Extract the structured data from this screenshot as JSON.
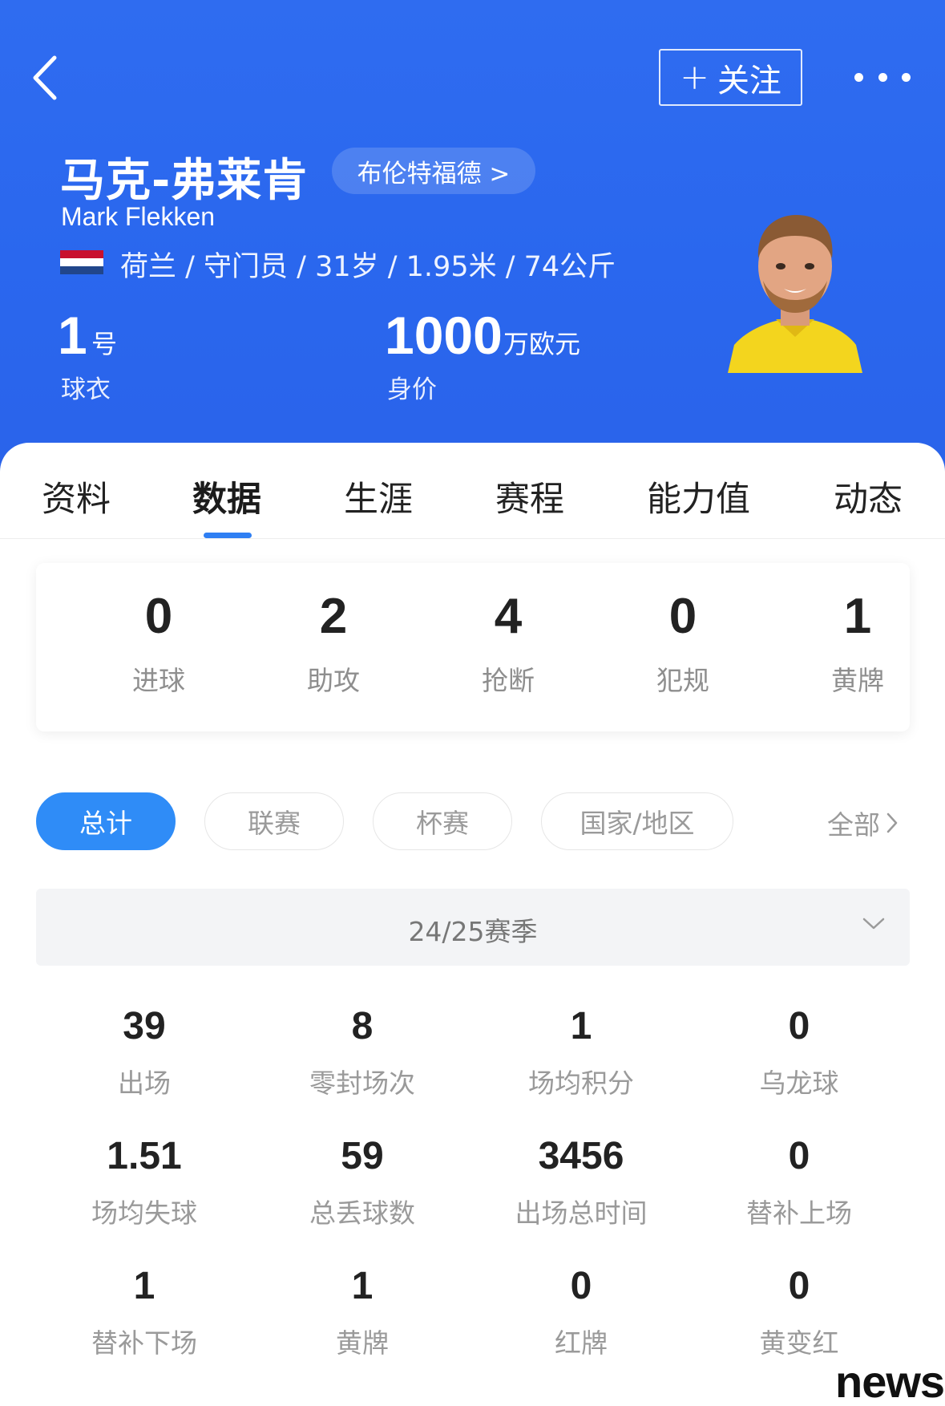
{
  "header": {
    "follow_plus": "+",
    "follow_label": "关注",
    "name_cn": "马克-弗莱肯",
    "team": "布伦特福德 >",
    "name_en": "Mark Flekken",
    "meta": "荷兰 / 守门员 / 31岁 / 1.95米 / 74公斤",
    "flag_colors": [
      "#c8102e",
      "#ffffff",
      "#21468b"
    ],
    "jersey": {
      "number": "1",
      "unit": "号",
      "label": "球衣"
    },
    "value": {
      "number": "1000",
      "unit": "万欧元",
      "label": "身价"
    }
  },
  "tabs": [
    {
      "label": "资料"
    },
    {
      "label": "数据"
    },
    {
      "label": "生涯"
    },
    {
      "label": "赛程"
    },
    {
      "label": "能力值"
    },
    {
      "label": "动态"
    }
  ],
  "summary": [
    {
      "value": "0",
      "label": "进球"
    },
    {
      "value": "2",
      "label": "助攻"
    },
    {
      "value": "4",
      "label": "抢断"
    },
    {
      "value": "0",
      "label": "犯规"
    },
    {
      "value": "1",
      "label": "黄牌"
    }
  ],
  "filters": [
    {
      "label": "总计"
    },
    {
      "label": "联赛"
    },
    {
      "label": "杯赛"
    },
    {
      "label": "国家/地区"
    }
  ],
  "all_label": "全部",
  "season": "24/25赛季",
  "stats": [
    {
      "value": "39",
      "label": "出场"
    },
    {
      "value": "8",
      "label": "零封场次"
    },
    {
      "value": "1",
      "label": "场均积分"
    },
    {
      "value": "0",
      "label": "乌龙球"
    },
    {
      "value": "1.51",
      "label": "场均失球"
    },
    {
      "value": "59",
      "label": "总丢球数"
    },
    {
      "value": "3456",
      "label": "出场总时间"
    },
    {
      "value": "0",
      "label": "替补上场"
    },
    {
      "value": "1",
      "label": "替补下场"
    },
    {
      "value": "1",
      "label": "黄牌"
    },
    {
      "value": "0",
      "label": "红牌"
    },
    {
      "value": "0",
      "label": "黄变红"
    }
  ],
  "watermark": "news",
  "colors": {
    "header_blue": "#2a67ee",
    "accent_blue": "#2f8cf7"
  }
}
